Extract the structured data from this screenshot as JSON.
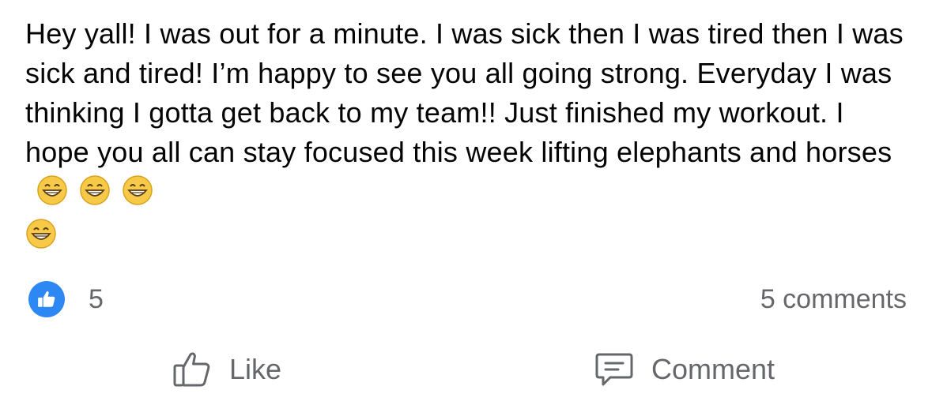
{
  "post": {
    "text": "Hey yall! I was out for a minute. I was sick then I was tired then I was sick and tired! I’m happy to see you all going strong. Everyday I was thinking I gotta get back to my team!! Just finished my workout. I hope you all can stay focused this week lifting elephants and horses",
    "emoji_icon": "grinning-face-icon",
    "emoji_count": 4
  },
  "reactions": {
    "icon": "thumbs-up-icon",
    "count": "5",
    "color": "#2e88f4"
  },
  "comments": {
    "label": "5 comments"
  },
  "actions": {
    "like_label": "Like",
    "like_icon": "thumbs-up-outline-icon",
    "comment_label": "Comment",
    "comment_icon": "comment-bubble-icon"
  }
}
